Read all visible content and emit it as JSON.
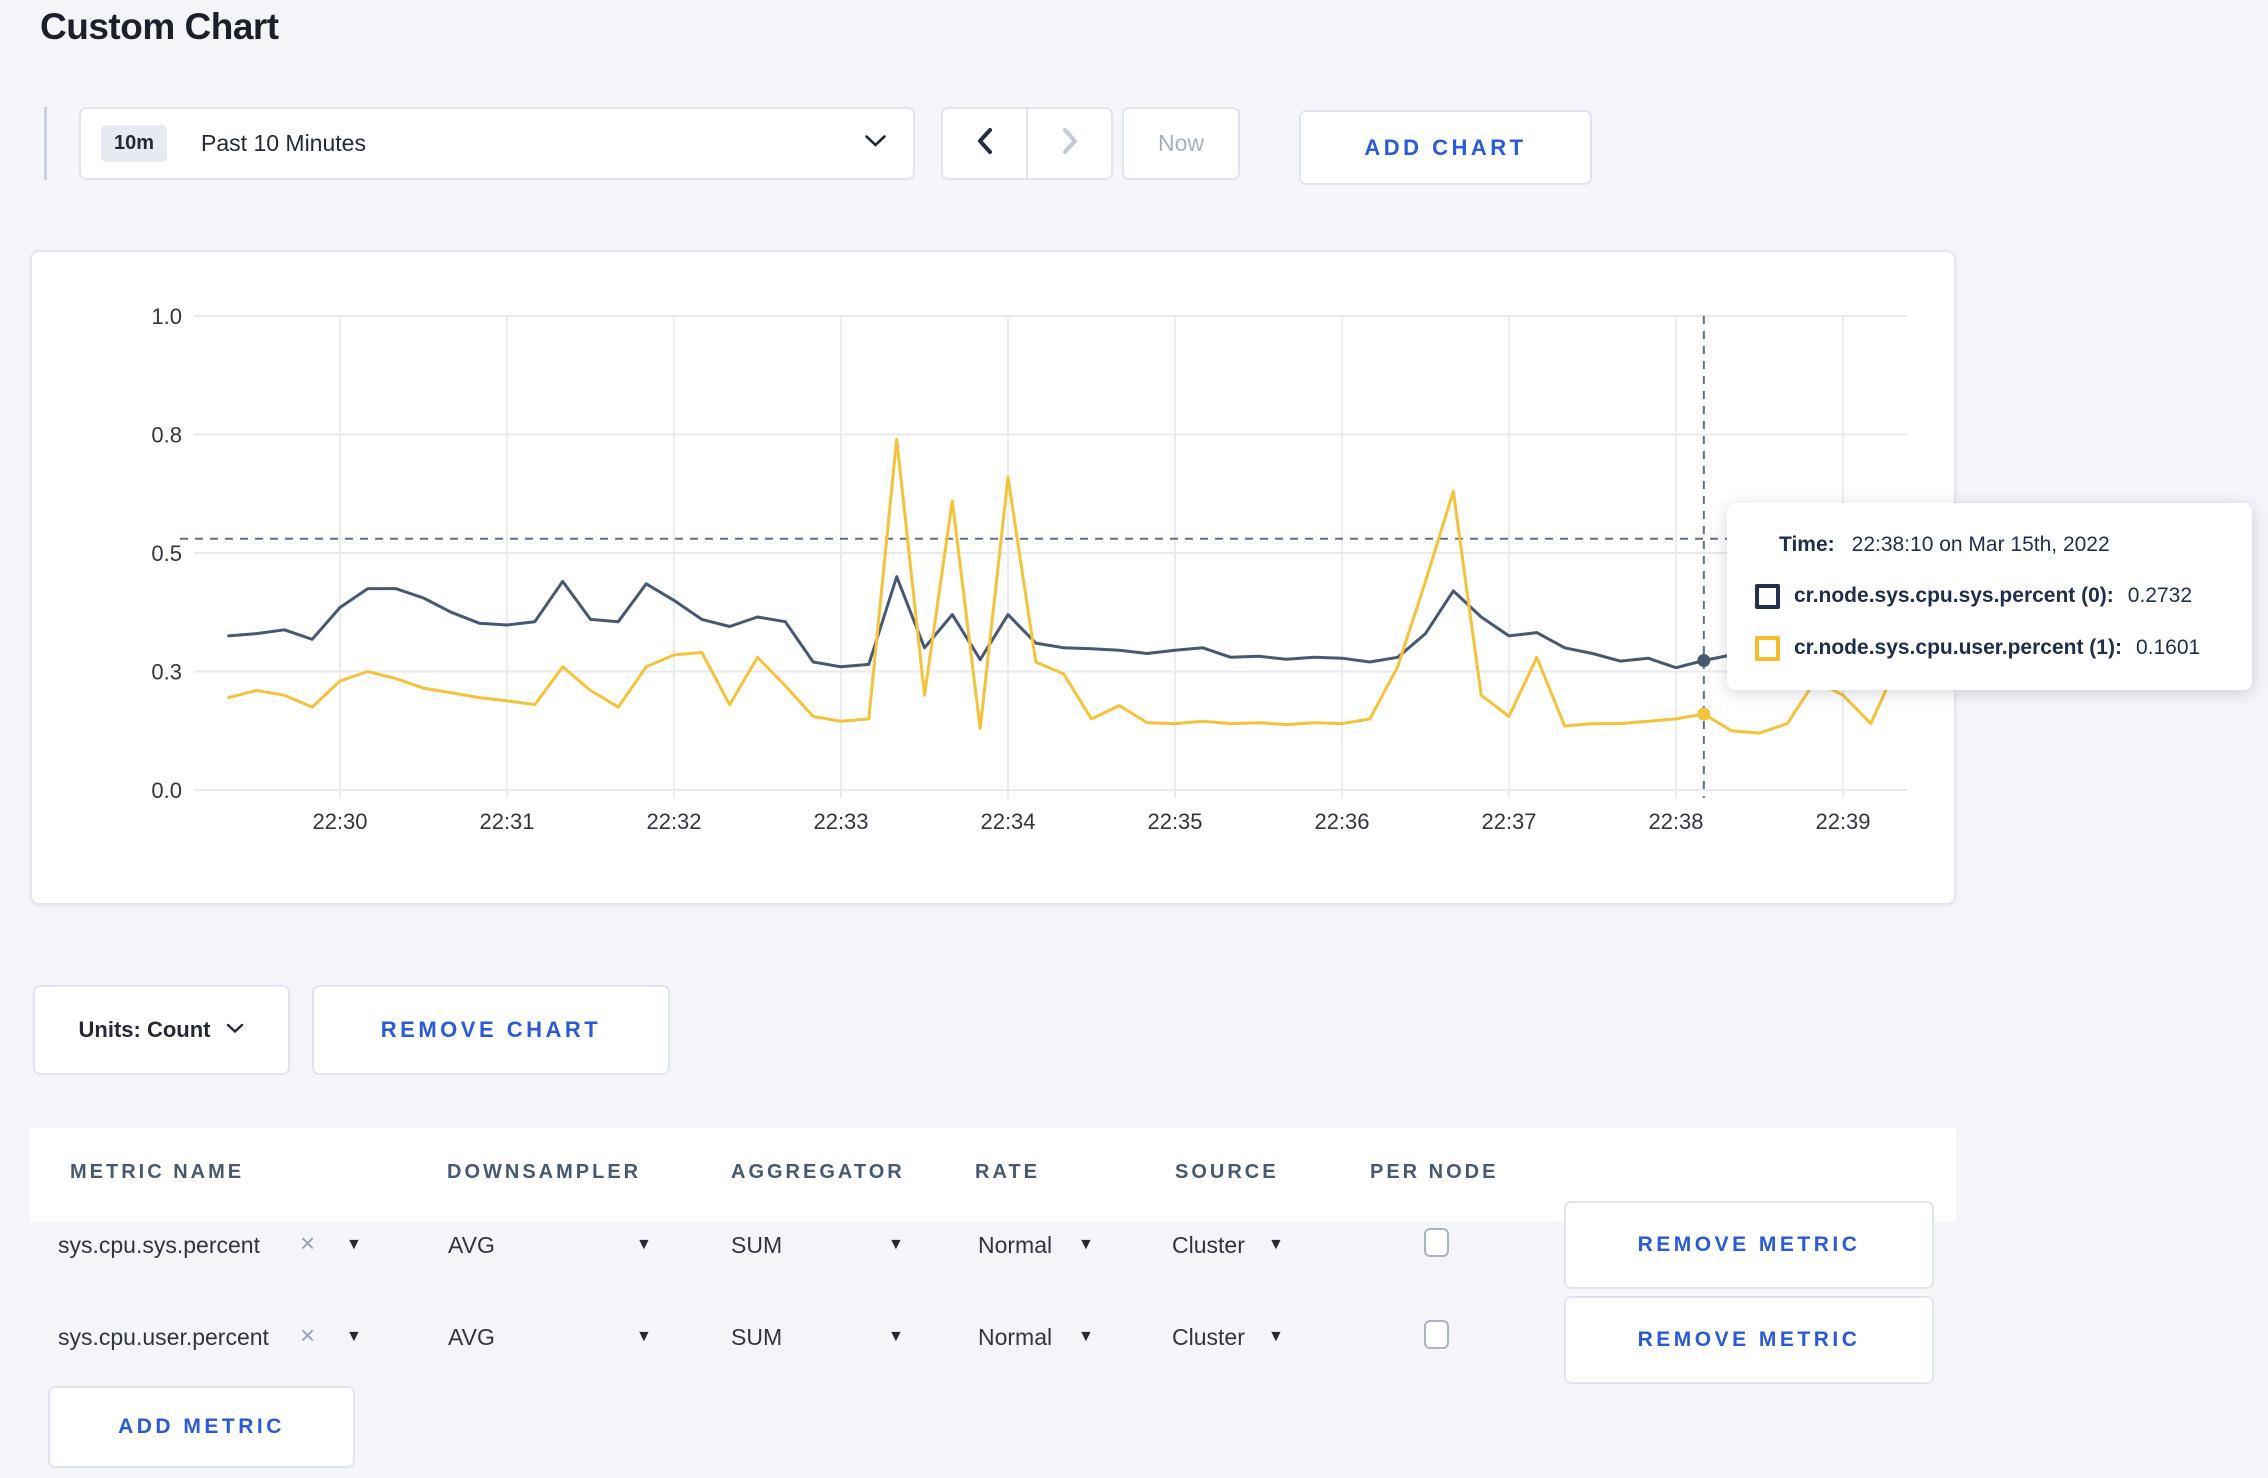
{
  "page": {
    "title": "Custom Chart"
  },
  "colors": {
    "accent_blue": "#2a5ada",
    "series_sys": "#475872",
    "series_user": "#f5c33b",
    "page_background": "#f4f5f9",
    "crosshair": "#5d6e8c"
  },
  "icons": {
    "dropdown_caret": "chevron-down",
    "prev_arrow": "chevron-left",
    "next_arrow": "chevron-right",
    "select_caret": "▼",
    "remove_tag": "×"
  },
  "toolbar": {
    "time_scale_badge": "10m",
    "time_scale_label": "Past 10 Minutes",
    "now_label": "Now",
    "add_chart_label": "ADD CHART"
  },
  "chart_data": {
    "type": "line",
    "title": "",
    "xlabel": "",
    "ylabel": "",
    "x_axis": {
      "tick_labels": [
        "22:30",
        "22:31",
        "22:32",
        "22:33",
        "22:34",
        "22:35",
        "22:36",
        "22:37",
        "22:38",
        "22:39"
      ]
    },
    "y_axis": {
      "range": [
        0,
        1
      ],
      "ticks": [
        {
          "value": 0,
          "label": "0.0"
        },
        {
          "value": 0.25,
          "label": "0.3"
        },
        {
          "value": 0.5,
          "label": "0.5"
        },
        {
          "value": 0.75,
          "label": "0.8"
        },
        {
          "value": 1,
          "label": "1.0"
        }
      ]
    },
    "grid": true,
    "x_start": "22:29:20",
    "x_step_seconds": 10,
    "series": [
      {
        "name": "cr.node.sys.cpu.sys.percent",
        "color": "#475872",
        "values": [
          0.325,
          0.33,
          0.338,
          0.318,
          0.385,
          0.425,
          0.425,
          0.405,
          0.375,
          0.352,
          0.348,
          0.355,
          0.44,
          0.36,
          0.355,
          0.435,
          0.4,
          0.36,
          0.345,
          0.365,
          0.355,
          0.27,
          0.26,
          0.265,
          0.45,
          0.3,
          0.37,
          0.275,
          0.37,
          0.31,
          0.3,
          0.298,
          0.295,
          0.288,
          0.295,
          0.3,
          0.28,
          0.282,
          0.276,
          0.28,
          0.278,
          0.27,
          0.28,
          0.33,
          0.42,
          0.365,
          0.325,
          0.332,
          0.3,
          0.288,
          0.272,
          0.278,
          0.258,
          0.2732,
          0.285,
          0.3,
          0.285,
          0.29,
          0.296,
          0.29,
          0.295
        ]
      },
      {
        "name": "cr.node.sys.cpu.user.percent",
        "color": "#f5c33b",
        "values": [
          0.195,
          0.21,
          0.2,
          0.175,
          0.23,
          0.25,
          0.235,
          0.215,
          0.205,
          0.195,
          0.188,
          0.18,
          0.26,
          0.21,
          0.175,
          0.26,
          0.285,
          0.29,
          0.18,
          0.28,
          0.22,
          0.155,
          0.145,
          0.15,
          0.74,
          0.2,
          0.61,
          0.13,
          0.66,
          0.27,
          0.245,
          0.15,
          0.178,
          0.142,
          0.14,
          0.145,
          0.14,
          0.142,
          0.138,
          0.142,
          0.14,
          0.15,
          0.26,
          0.44,
          0.63,
          0.2,
          0.155,
          0.28,
          0.135,
          0.14,
          0.14,
          0.145,
          0.15,
          0.1601,
          0.125,
          0.12,
          0.14,
          0.23,
          0.2,
          0.14,
          0.27
        ]
      }
    ],
    "crosshair": {
      "time": "22:38:10",
      "hline_value": 0.53,
      "points": [
        {
          "series": 0,
          "value": 0.2732
        },
        {
          "series": 1,
          "value": 0.1601
        }
      ]
    },
    "legend_position": "tooltip"
  },
  "tooltip": {
    "time_label": "Time:",
    "time_value": "22:38:10 on Mar 15th, 2022",
    "rows": [
      {
        "label": "cr.node.sys.cpu.sys.percent (0):",
        "value": "0.2732",
        "swatch_color": "#22304e"
      },
      {
        "label": "cr.node.sys.cpu.user.percent (1):",
        "value": "0.1601",
        "swatch_color": "#f2be2c"
      }
    ]
  },
  "chart_controls": {
    "units_label": "Units: Count",
    "remove_chart_label": "REMOVE CHART"
  },
  "metrics_table": {
    "headers": [
      "METRIC NAME",
      "DOWNSAMPLER",
      "AGGREGATOR",
      "RATE",
      "SOURCE",
      "PER NODE"
    ],
    "rows": [
      {
        "name": "sys.cpu.sys.percent",
        "downsampler": "AVG",
        "aggregator": "SUM",
        "rate": "Normal",
        "source": "Cluster",
        "per_node_checked": false
      },
      {
        "name": "sys.cpu.user.percent",
        "downsampler": "AVG",
        "aggregator": "SUM",
        "rate": "Normal",
        "source": "Cluster",
        "per_node_checked": false
      }
    ],
    "remove_metric_label": "REMOVE METRIC",
    "add_metric_label": "ADD METRIC"
  }
}
